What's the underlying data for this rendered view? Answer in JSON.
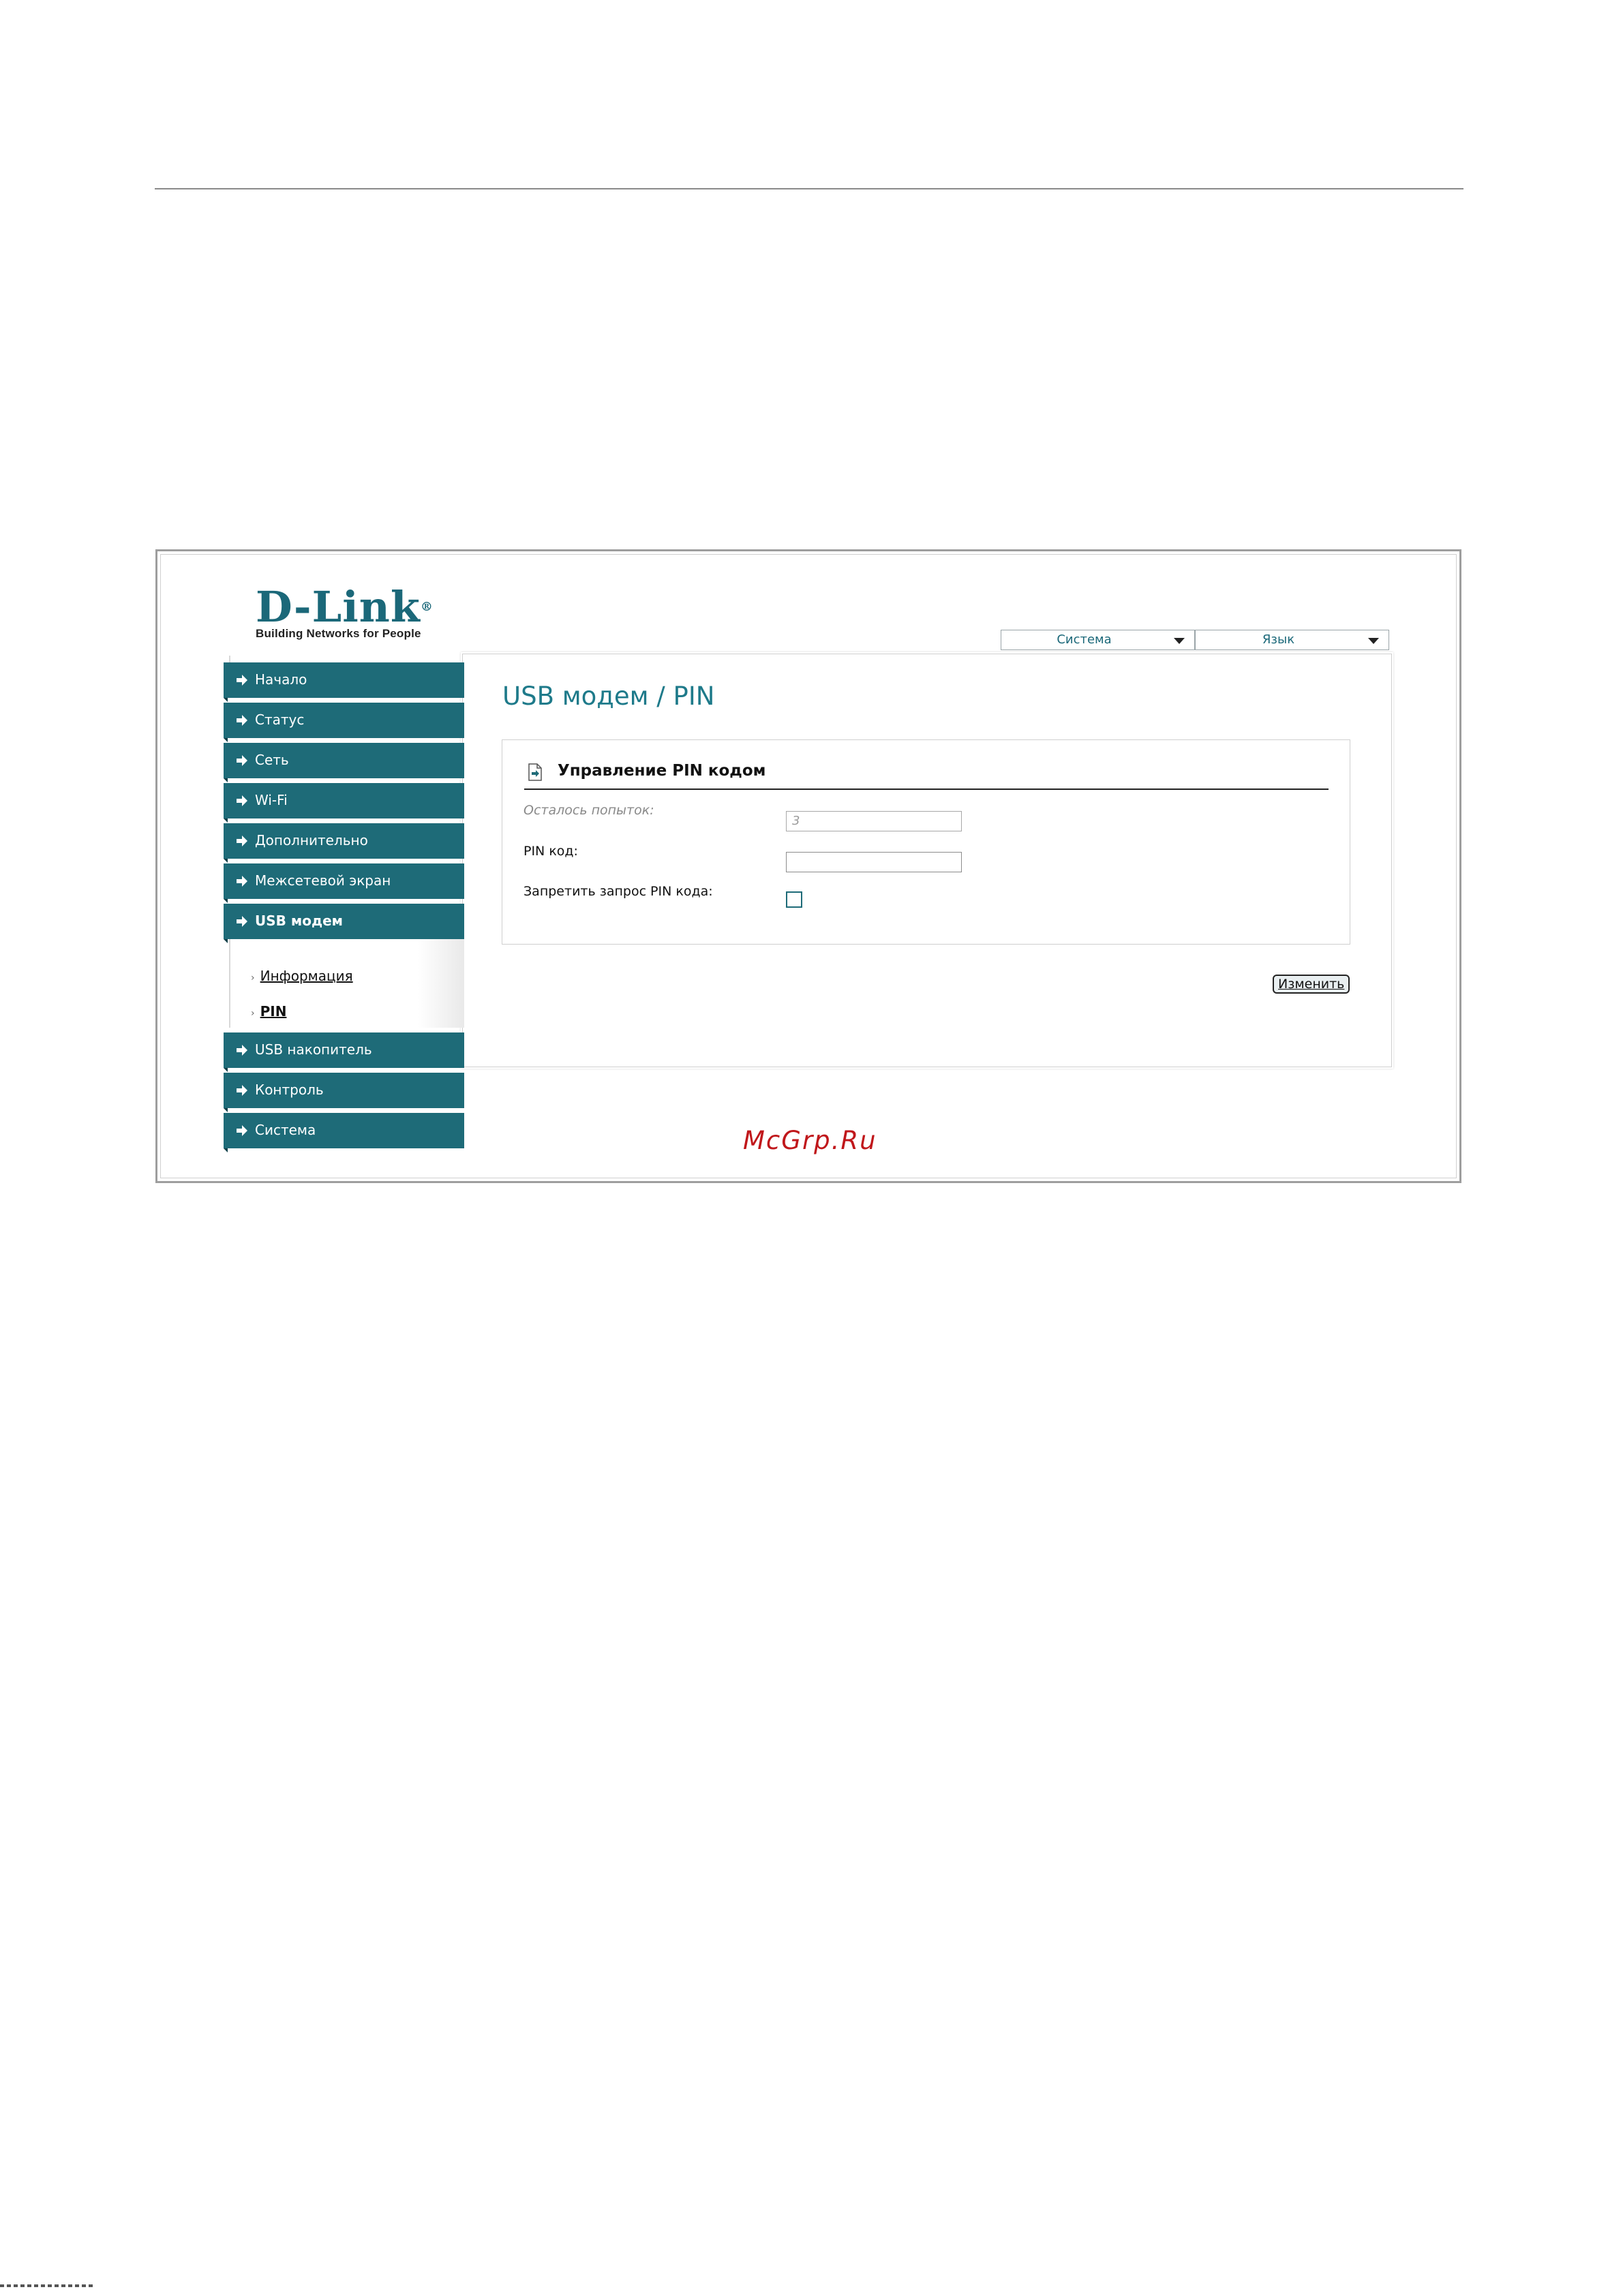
{
  "logo": {
    "name": "D-Link",
    "tagline": "Building Networks for People"
  },
  "top_menu": {
    "system": "Система",
    "language": "Язык"
  },
  "sidebar": {
    "items": [
      {
        "label": "Начало"
      },
      {
        "label": "Статус"
      },
      {
        "label": "Сеть"
      },
      {
        "label": "Wi-Fi"
      },
      {
        "label": "Дополнительно"
      },
      {
        "label": "Межсетевой экран"
      },
      {
        "label": "USB модем",
        "active": true
      },
      {
        "label": "USB накопитель"
      },
      {
        "label": "Контроль"
      },
      {
        "label": "Система"
      }
    ],
    "subitems": [
      {
        "label": "Информация"
      },
      {
        "label": "PIN",
        "current": true
      }
    ]
  },
  "main": {
    "title": "USB модем / PIN",
    "section_title": "Управление PIN кодом",
    "attempts_label": "Осталось попыток:",
    "attempts_value": "3",
    "pin_label": "PIN код:",
    "pin_value": "",
    "disable_pin_label": "Запретить запрос PIN кода:",
    "disable_pin_checked": false,
    "change_button": "Изменить"
  },
  "watermark": "McGrp.Ru",
  "colors": {
    "accent": "#1e6b78",
    "title": "#1e7a8a",
    "watermark": "#c0171b"
  },
  "icons": {
    "sidebar_item": "arrow-right-icon",
    "section": "document-icon",
    "dropdown": "chevron-down-icon"
  }
}
